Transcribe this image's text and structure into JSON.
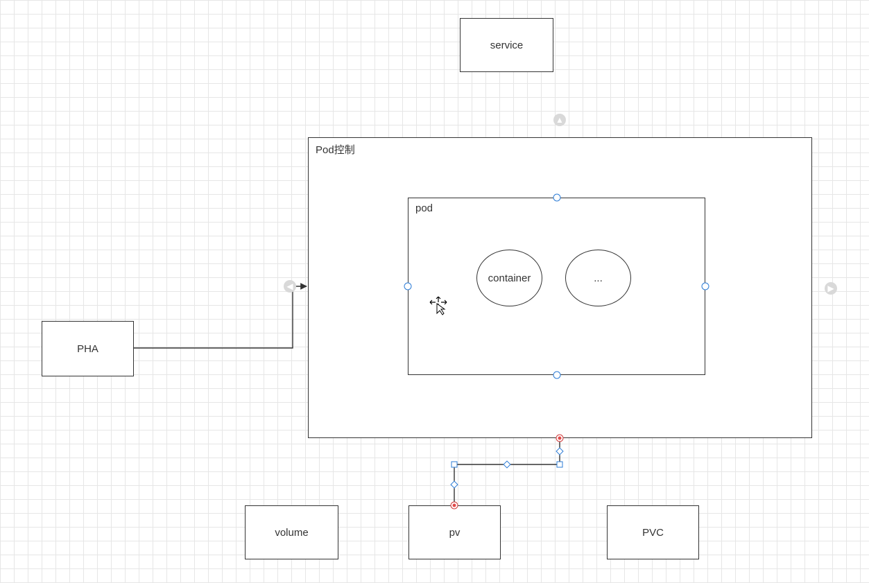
{
  "nodes": {
    "service": {
      "label": "service"
    },
    "pha": {
      "label": "PHA"
    },
    "pod_controller": {
      "label": "Pod控制"
    },
    "pod": {
      "label": "pod"
    },
    "container": {
      "label": "container"
    },
    "more_containers": {
      "label": "..."
    },
    "volume": {
      "label": "volume"
    },
    "pv": {
      "label": "pv"
    },
    "pvc": {
      "label": "PVC"
    }
  },
  "edges": [
    {
      "from": "pha",
      "to": "pod_controller",
      "style": "arrow"
    },
    {
      "from": "pod_controller",
      "to": "pv",
      "style": "selected-elbow"
    }
  ],
  "selection": "pod",
  "colors": {
    "grid": "#e6e6e6",
    "box_border": "#333333",
    "selection": "#2b7bd6",
    "endpoint": "#e24b4b",
    "hint": "#d9d9d9"
  }
}
